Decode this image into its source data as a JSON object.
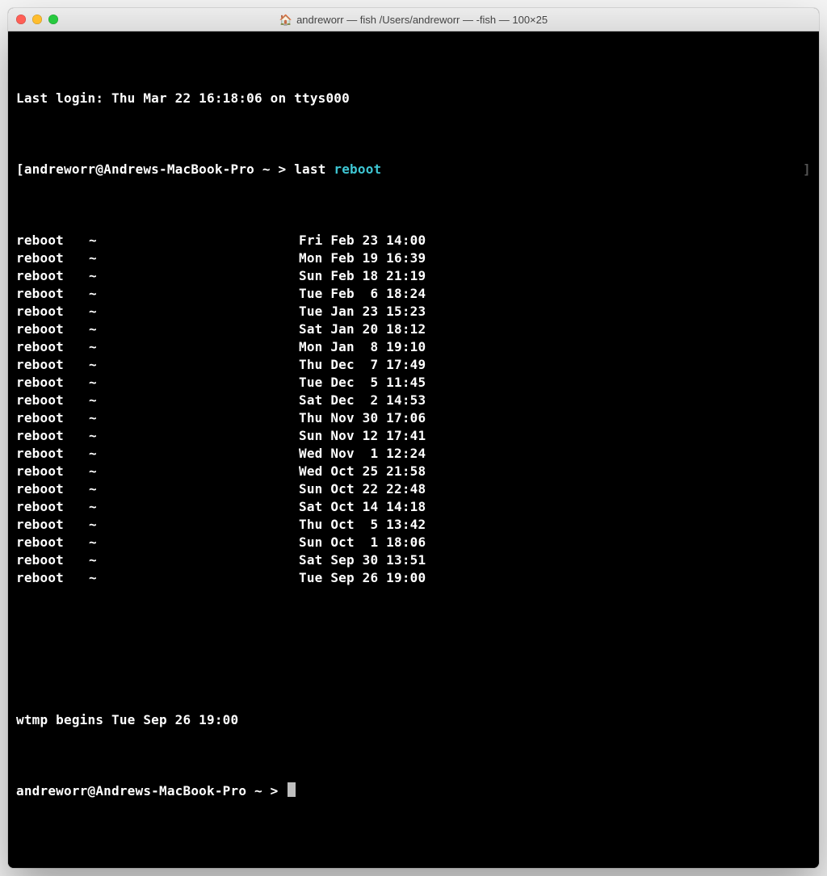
{
  "window": {
    "title": "andreworr — fish  /Users/andreworr — -fish — 100×25"
  },
  "terminal": {
    "login_banner": "Last login: Thu Mar 22 16:18:06 on ttys000",
    "prompt1": {
      "left_bracket": "[",
      "host_path": "andreworr@Andrews-MacBook-Pro ~",
      "arrow": ">",
      "command": "last",
      "arg": "reboot",
      "right_bracket_dim": "]"
    },
    "rows": [
      {
        "user": "reboot",
        "tty": "~",
        "time": "Fri Feb 23 14:00"
      },
      {
        "user": "reboot",
        "tty": "~",
        "time": "Mon Feb 19 16:39"
      },
      {
        "user": "reboot",
        "tty": "~",
        "time": "Sun Feb 18 21:19"
      },
      {
        "user": "reboot",
        "tty": "~",
        "time": "Tue Feb  6 18:24"
      },
      {
        "user": "reboot",
        "tty": "~",
        "time": "Tue Jan 23 15:23"
      },
      {
        "user": "reboot",
        "tty": "~",
        "time": "Sat Jan 20 18:12"
      },
      {
        "user": "reboot",
        "tty": "~",
        "time": "Mon Jan  8 19:10"
      },
      {
        "user": "reboot",
        "tty": "~",
        "time": "Thu Dec  7 17:49"
      },
      {
        "user": "reboot",
        "tty": "~",
        "time": "Tue Dec  5 11:45"
      },
      {
        "user": "reboot",
        "tty": "~",
        "time": "Sat Dec  2 14:53"
      },
      {
        "user": "reboot",
        "tty": "~",
        "time": "Thu Nov 30 17:06"
      },
      {
        "user": "reboot",
        "tty": "~",
        "time": "Sun Nov 12 17:41"
      },
      {
        "user": "reboot",
        "tty": "~",
        "time": "Wed Nov  1 12:24"
      },
      {
        "user": "reboot",
        "tty": "~",
        "time": "Wed Oct 25 21:58"
      },
      {
        "user": "reboot",
        "tty": "~",
        "time": "Sun Oct 22 22:48"
      },
      {
        "user": "reboot",
        "tty": "~",
        "time": "Sat Oct 14 14:18"
      },
      {
        "user": "reboot",
        "tty": "~",
        "time": "Thu Oct  5 13:42"
      },
      {
        "user": "reboot",
        "tty": "~",
        "time": "Sun Oct  1 18:06"
      },
      {
        "user": "reboot",
        "tty": "~",
        "time": "Sat Sep 30 13:51"
      },
      {
        "user": "reboot",
        "tty": "~",
        "time": "Tue Sep 26 19:00"
      }
    ],
    "footer": "wtmp begins Tue Sep 26 19:00",
    "prompt2": {
      "host_path": "andreworr@Andrews-MacBook-Pro ~",
      "arrow": ">"
    }
  }
}
